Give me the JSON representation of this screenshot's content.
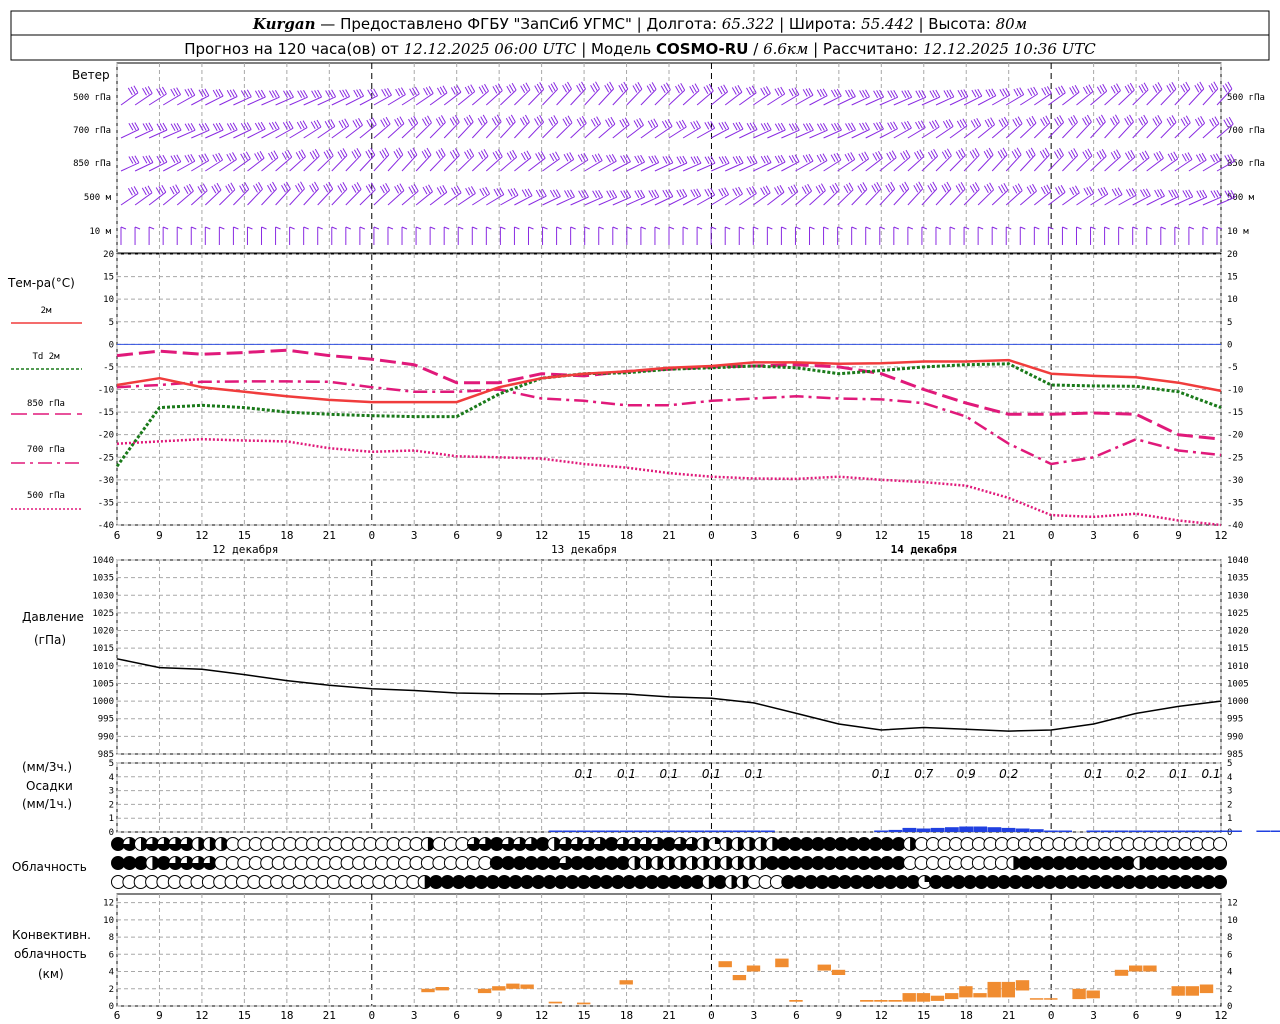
{
  "header": {
    "station": "Kurgan",
    "provider": "Предоставлено ФГБУ \"ЗапСиб УГМС\"",
    "lon_label": "Долгота:",
    "lon": "65.322",
    "lat_label": "Широта:",
    "lat": "55.442",
    "alt_label": "Высота:",
    "alt": "80м",
    "forecast_label": "Прогноз на 120 часа(ов) от",
    "forecast_start": "12.12.2025 06:00 UTC",
    "model_label": "Модель",
    "model": "COSMO-RU",
    "resolution": "6.6км",
    "calc_label": "Рассчитано:",
    "calc_time": "12.12.2025 10:36 UTC"
  },
  "colors": {
    "wind": "#8a2be2",
    "t2m": "#f03c3c",
    "td": "#1a7a1a",
    "t850": "#e0197a",
    "t700": "#e0197a",
    "t500": "#e0197a",
    "pressure": "#000000",
    "precip": "#2040e0",
    "convective": "#f08c30",
    "zero_line": "#3050e0"
  },
  "wind_panel": {
    "title": "Ветер",
    "levels": [
      "500 гПа",
      "700 гПа",
      "850 гПа",
      "500 м",
      "10  м"
    ]
  },
  "temp_panel": {
    "title": "Тем-ра(°С)",
    "legend": [
      "2м",
      "Td  2м",
      "850 гПа",
      "700 гПа",
      "500 гПа"
    ],
    "ylim": [
      -40,
      20
    ],
    "yticks": [
      20,
      15,
      10,
      5,
      0,
      -5,
      -10,
      -15,
      -20,
      -25,
      -30,
      -35,
      -40
    ]
  },
  "time_axis": {
    "hour_labels": [
      "6",
      "9",
      "12",
      "15",
      "18",
      "21",
      "0",
      "3",
      "6",
      "9",
      "12",
      "15",
      "18",
      "21",
      "0",
      "3",
      "6",
      "9",
      "12",
      "15",
      "18",
      "21",
      "0",
      "3",
      "6",
      "9",
      "12"
    ],
    "day_labels": [
      "12 декабря",
      "13 декабря",
      "14 декабря"
    ]
  },
  "pressure_panel": {
    "title1": "Давление",
    "title2": "(гПа)",
    "ylim": [
      985,
      1040
    ],
    "yticks": [
      1040,
      1035,
      1030,
      1025,
      1020,
      1015,
      1010,
      1005,
      1000,
      995,
      990,
      985
    ]
  },
  "precip_panel": {
    "title1": "(мм/3ч.)",
    "title2": "Осадки",
    "title3": "(мм/1ч.)",
    "ylim": [
      0,
      5
    ],
    "yticks": [
      5,
      4,
      3,
      2,
      1,
      0
    ]
  },
  "cloud_panel": {
    "title": "Облачность"
  },
  "conv_panel": {
    "title1": "Конвективн.",
    "title2": "облачность",
    "title3": "(км)",
    "ylim": [
      0,
      13
    ],
    "yticks": [
      12,
      10,
      8,
      6,
      4,
      2,
      0
    ]
  },
  "chart_data": {
    "type": "line",
    "x_hours": [
      0,
      3,
      6,
      9,
      12,
      15,
      18,
      21,
      24,
      27,
      30,
      33,
      36,
      39,
      42,
      45,
      48,
      51,
      54,
      57,
      60,
      63,
      66,
      69,
      72,
      75,
      78
    ],
    "temperature": {
      "t2m": [
        -9,
        -7.5,
        -9.5,
        -10.5,
        -11.5,
        -12.3,
        -12.8,
        -12.8,
        -12.8,
        -9.5,
        -7.5,
        -6.5,
        -6,
        -5.2,
        -4.8,
        -4,
        -4,
        -4.3,
        -4.2,
        -3.8,
        -3.8,
        -3.5,
        -6.5,
        -7,
        -7.3,
        -8.5,
        -10.3
      ],
      "td": [
        -27,
        -14,
        -13.5,
        -14,
        -15,
        -15.5,
        -15.8,
        -16,
        -16,
        -11,
        -7.5,
        -6.5,
        -6.3,
        -5.5,
        -5.2,
        -4.8,
        -5.2,
        -6.5,
        -5.8,
        -5,
        -4.5,
        -4.3,
        -9,
        -9.2,
        -9.3,
        -10.5,
        -14
      ],
      "t850": [
        -2.5,
        -1.5,
        -2.2,
        -1.8,
        -1.3,
        -2.5,
        -3.3,
        -4.5,
        -8.5,
        -8.5,
        -6.5,
        -7,
        -6,
        -5.5,
        -5,
        -4.8,
        -4.5,
        -5,
        -6.5,
        -10,
        -13,
        -15.5,
        -15.5,
        -15.2,
        -15.5,
        -20,
        -21
      ],
      "t700": [
        -9.5,
        -9,
        -8.3,
        -8.2,
        -8.2,
        -8.3,
        -9.5,
        -10.5,
        -10.5,
        -10,
        -12,
        -12.5,
        -13.5,
        -13.5,
        -12.5,
        -12,
        -11.5,
        -12,
        -12.2,
        -13,
        -16,
        -22,
        -26.5,
        -25,
        -21,
        -23.5,
        -24.5
      ],
      "t500": [
        -22,
        -21.5,
        -21,
        -21.3,
        -21.5,
        -23,
        -23.8,
        -23.5,
        -24.8,
        -25,
        -25.3,
        -26.5,
        -27.3,
        -28.5,
        -29.3,
        -29.7,
        -29.8,
        -29.3,
        -30,
        -30.5,
        -31.3,
        -34,
        -37.8,
        -38.2,
        -37.5,
        -39,
        -40
      ]
    },
    "pressure": [
      1012,
      1009.5,
      1009,
      1007.5,
      1005.8,
      1004.5,
      1003.5,
      1003,
      1002.3,
      1002.1,
      1002,
      1002.3,
      1002,
      1001.2,
      1000.8,
      999.5,
      996.5,
      993.5,
      991.8,
      992.5,
      992,
      991.5,
      991.8,
      993.5,
      996.5,
      998.5,
      1000
    ],
    "precip_labels": [
      {
        "h": 33,
        "v": "0.1"
      },
      {
        "h": 36,
        "v": "0.1"
      },
      {
        "h": 39,
        "v": "0.1"
      },
      {
        "h": 42,
        "v": "0.1"
      },
      {
        "h": 45,
        "v": "0.1"
      },
      {
        "h": 54,
        "v": "0.1"
      },
      {
        "h": 57,
        "v": "0.7"
      },
      {
        "h": 60,
        "v": "0.9"
      },
      {
        "h": 63,
        "v": "0.2"
      },
      {
        "h": 69,
        "v": "0.1"
      },
      {
        "h": 72,
        "v": "0.2"
      },
      {
        "h": 75,
        "v": "0.1"
      },
      {
        "h": 81,
        "v": "0.1"
      }
    ],
    "precip_hourly": [
      0,
      0,
      0,
      0,
      0,
      0,
      0,
      0,
      0,
      0,
      0,
      0,
      0,
      0,
      0,
      0,
      0,
      0,
      0,
      0,
      0,
      0,
      0,
      0,
      0,
      0,
      0,
      0,
      0,
      0,
      0,
      0.05,
      0.05,
      0.05,
      0.05,
      0.05,
      0.05,
      0.05,
      0.05,
      0.05,
      0.05,
      0.05,
      0.05,
      0.05,
      0.1,
      0.1,
      0.05,
      0,
      0,
      0,
      0,
      0,
      0,
      0,
      0.1,
      0.15,
      0.3,
      0.25,
      0.3,
      0.35,
      0.4,
      0.4,
      0.35,
      0.3,
      0.25,
      0.2,
      0.1,
      0.05,
      0,
      0.05,
      0.1,
      0.1,
      0.1,
      0.1,
      0.1,
      0.1,
      0.05,
      0.05,
      0.1,
      0.05,
      0,
      0.05,
      0.05,
      0.05,
      0.05
    ],
    "cloud_rows": {
      "row1": [
        4,
        3,
        2,
        3,
        3,
        3,
        3,
        2,
        2,
        2,
        0,
        0,
        0,
        0,
        0,
        0,
        0,
        0,
        0,
        0,
        0,
        0,
        0,
        0,
        0,
        0,
        0,
        2,
        0,
        0,
        0,
        3,
        3,
        4,
        3,
        3,
        3,
        4,
        2,
        3,
        3,
        3,
        3,
        4,
        3,
        3,
        3,
        3,
        4,
        3,
        3,
        2,
        1,
        2,
        2,
        2,
        2,
        2,
        4,
        4,
        4,
        4,
        4,
        4,
        4,
        4,
        4,
        4,
        4,
        2,
        0,
        0,
        0,
        0,
        0,
        0,
        0,
        0,
        0,
        0,
        0,
        0,
        0,
        0,
        0,
        0,
        0,
        0,
        0,
        0,
        0,
        0,
        0,
        0,
        0,
        0,
        0
      ],
      "row2": [
        4,
        4,
        4,
        2,
        4,
        3,
        3,
        3,
        3,
        0,
        0,
        0,
        0,
        0,
        0,
        0,
        0,
        0,
        0,
        0,
        0,
        0,
        0,
        0,
        0,
        0,
        0,
        0,
        0,
        0,
        0,
        0,
        0,
        4,
        4,
        4,
        4,
        4,
        4,
        3,
        4,
        4,
        4,
        4,
        4,
        2,
        2,
        2,
        2,
        2,
        2,
        2,
        2,
        2,
        2,
        2,
        2,
        4,
        4,
        4,
        4,
        4,
        4,
        4,
        4,
        4,
        4,
        4,
        4,
        0,
        0,
        0,
        0,
        0,
        0,
        0,
        0,
        0,
        2,
        4,
        4,
        4,
        4,
        4,
        4,
        4,
        4,
        4,
        4,
        2,
        4,
        4,
        4,
        4,
        4,
        4,
        4
      ],
      "row3": [
        0,
        0,
        0,
        0,
        0,
        0,
        0,
        0,
        0,
        0,
        0,
        0,
        0,
        0,
        0,
        0,
        0,
        0,
        0,
        0,
        0,
        0,
        0,
        0,
        0,
        0,
        0,
        2,
        4,
        4,
        4,
        4,
        4,
        4,
        4,
        4,
        4,
        4,
        4,
        4,
        4,
        4,
        4,
        4,
        4,
        4,
        4,
        4,
        4,
        4,
        4,
        4,
        2,
        4,
        2,
        2,
        0,
        0,
        0,
        4,
        4,
        4,
        4,
        4,
        4,
        4,
        4,
        4,
        4,
        4,
        4,
        1,
        4,
        4,
        4,
        4,
        4,
        4,
        4,
        4,
        4,
        4,
        4,
        4,
        4,
        4,
        4,
        4,
        4,
        4,
        4,
        4,
        4,
        4,
        4,
        4,
        4,
        4
      ]
    },
    "convective": [
      {
        "h": 22,
        "b": 1.6,
        "t": 2.0
      },
      {
        "h": 23,
        "b": 1.8,
        "t": 2.2
      },
      {
        "h": 26,
        "b": 1.5,
        "t": 2.0
      },
      {
        "h": 27,
        "b": 1.8,
        "t": 2.3
      },
      {
        "h": 28,
        "b": 2.0,
        "t": 2.6
      },
      {
        "h": 29,
        "b": 2.0,
        "t": 2.5
      },
      {
        "h": 31,
        "b": 0.3,
        "t": 0.5
      },
      {
        "h": 33,
        "b": 0.2,
        "t": 0.4
      },
      {
        "h": 36,
        "b": 2.5,
        "t": 3.0
      },
      {
        "h": 43,
        "b": 4.5,
        "t": 5.2
      },
      {
        "h": 44,
        "b": 3.0,
        "t": 3.6
      },
      {
        "h": 45,
        "b": 4.0,
        "t": 4.7
      },
      {
        "h": 47,
        "b": 4.5,
        "t": 5.5
      },
      {
        "h": 48,
        "b": 0.5,
        "t": 0.7
      },
      {
        "h": 50,
        "b": 4.1,
        "t": 4.8
      },
      {
        "h": 51,
        "b": 3.6,
        "t": 4.2
      },
      {
        "h": 53,
        "b": 0.5,
        "t": 0.7
      },
      {
        "h": 54,
        "b": 0.5,
        "t": 0.7
      },
      {
        "h": 55,
        "b": 0.5,
        "t": 0.7
      },
      {
        "h": 56,
        "b": 0.5,
        "t": 1.5
      },
      {
        "h": 57,
        "b": 0.5,
        "t": 1.5
      },
      {
        "h": 58,
        "b": 0.6,
        "t": 1.2
      },
      {
        "h": 59,
        "b": 0.8,
        "t": 1.5
      },
      {
        "h": 60,
        "b": 1.0,
        "t": 2.3
      },
      {
        "h": 61,
        "b": 1.0,
        "t": 1.5
      },
      {
        "h": 62,
        "b": 1.0,
        "t": 2.8
      },
      {
        "h": 63,
        "b": 1.0,
        "t": 2.8
      },
      {
        "h": 64,
        "b": 1.8,
        "t": 3.0
      },
      {
        "h": 65,
        "b": 0.8,
        "t": 0.9
      },
      {
        "h": 66,
        "b": 0.8,
        "t": 0.9
      },
      {
        "h": 68,
        "b": 0.8,
        "t": 2.0
      },
      {
        "h": 69,
        "b": 0.9,
        "t": 1.8
      },
      {
        "h": 71,
        "b": 3.5,
        "t": 4.2
      },
      {
        "h": 72,
        "b": 4.0,
        "t": 4.7
      },
      {
        "h": 73,
        "b": 4.0,
        "t": 4.7
      },
      {
        "h": 75,
        "b": 1.2,
        "t": 2.3
      },
      {
        "h": 76,
        "b": 1.2,
        "t": 2.3
      },
      {
        "h": 77,
        "b": 1.5,
        "t": 2.5
      }
    ]
  }
}
